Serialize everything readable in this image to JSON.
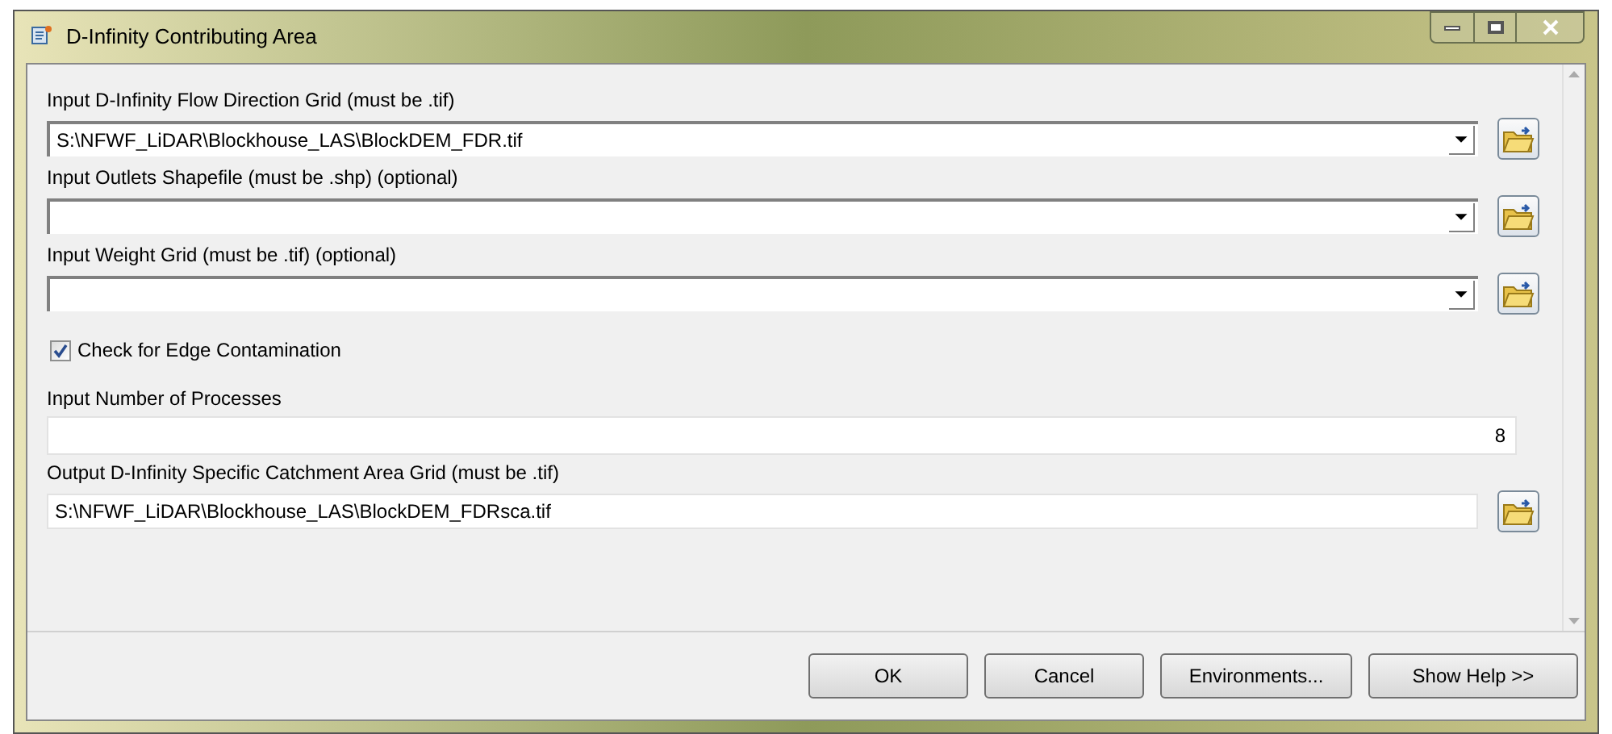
{
  "window": {
    "title": "D-Infinity Contributing Area"
  },
  "params": [
    {
      "kind": "combo",
      "label": "Input D-Infinity Flow Direction Grid (must be .tif)",
      "value": "S:\\NFWF_LiDAR\\Blockhouse_LAS\\BlockDEM_FDR.tif"
    },
    {
      "kind": "combo",
      "label": "Input Outlets Shapefile (must be .shp) (optional)"
    },
    {
      "kind": "combo",
      "label": "Input Weight Grid (must be .tif) (optional)"
    },
    {
      "kind": "checkbox",
      "label": "Check for Edge Contamination",
      "checked": true
    },
    {
      "kind": "number",
      "label": "Input Number of Processes",
      "value": "8"
    },
    {
      "kind": "text",
      "label": "Output D-Infinity Specific Catchment Area Grid (must be .tif)",
      "value": "S:\\NFWF_LiDAR\\Blockhouse_LAS\\BlockDEM_FDRsca.tif"
    }
  ],
  "buttons": [
    "OK",
    "Cancel",
    "Environments...",
    "Show Help >>"
  ]
}
